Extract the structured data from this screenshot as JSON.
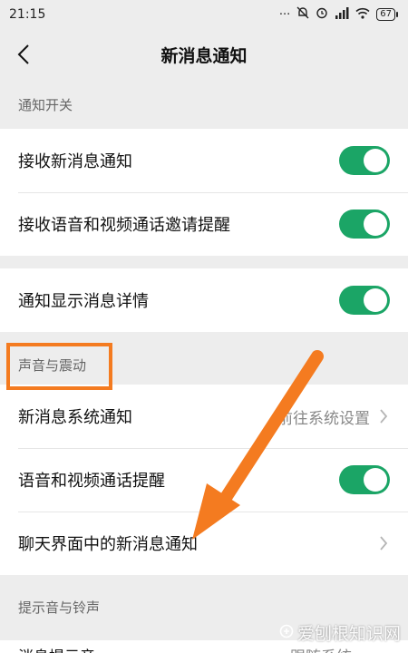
{
  "status_bar": {
    "time": "21:15",
    "battery": "67",
    "icons": [
      "dots-icon",
      "mute-icon",
      "alarm-icon",
      "signal-icon",
      "wifi-icon",
      "battery-icon"
    ]
  },
  "nav": {
    "title": "新消息通知",
    "back_icon": "chevron-left-icon"
  },
  "sections": {
    "notify_switch": "通知开关",
    "sound_vibration": "声音与震动",
    "ringtone": "提示音与铃声"
  },
  "rows": {
    "receive_new": {
      "label": "接收新消息通知",
      "toggle_on": true
    },
    "receive_call_invite": {
      "label": "接收语音和视频通话邀请提醒",
      "toggle_on": true
    },
    "show_details": {
      "label": "通知显示消息详情",
      "toggle_on": true
    },
    "system_notify": {
      "label": "新消息系统通知",
      "value": "前往系统设置"
    },
    "call_remind": {
      "label": "语音和视频通话提醒",
      "toggle_on": true
    },
    "chat_notify": {
      "label": "聊天界面中的新消息通知"
    },
    "message_tone": {
      "label": "消息提示音",
      "value": "跟随系统"
    }
  },
  "colors": {
    "accent": "#1ba566",
    "annotation": "#f47b20",
    "background": "#ededed"
  },
  "watermark": {
    "text": "爱刨根知识网"
  }
}
